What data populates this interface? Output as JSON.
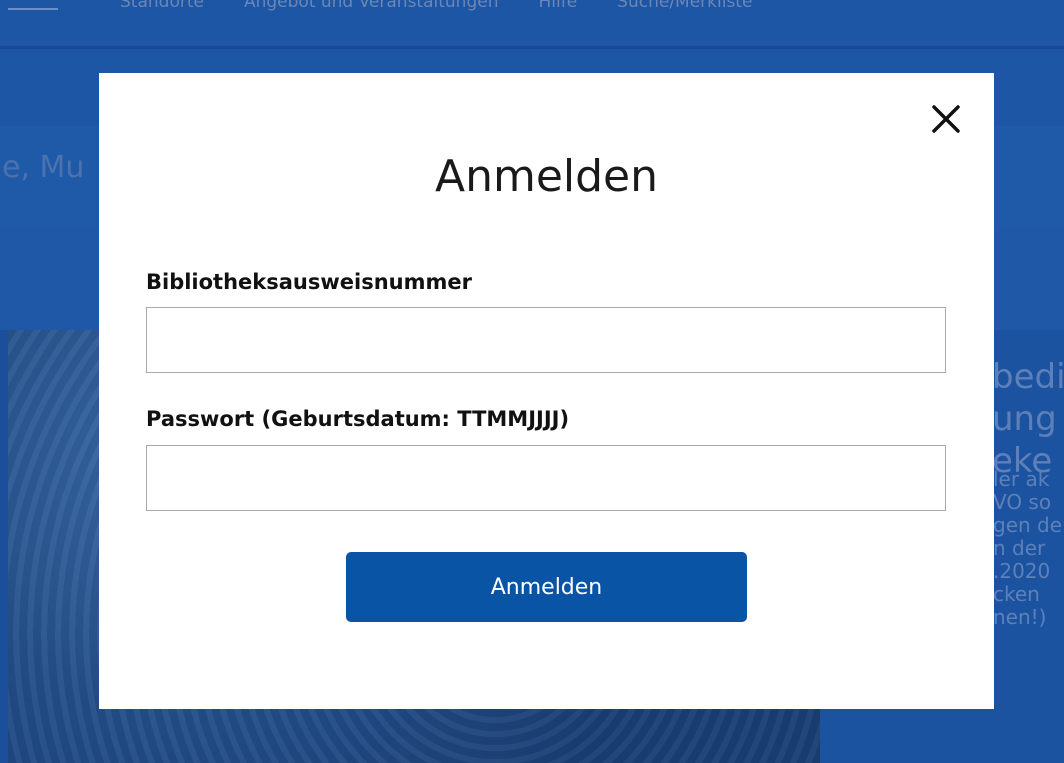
{
  "background": {
    "nav_items": [
      "Standorte",
      "Angebot und Veranstaltungen",
      "Hilfe",
      "Suche/Merkliste"
    ],
    "page_title_fragment": "e, Mu",
    "side_heading": "bedi\nung\neke",
    "side_text": "ler ak\nVO so\ngen de\nn der\n.2020\ncken\nnen!)"
  },
  "modal": {
    "title": "Anmelden",
    "card_label": "Bibliotheksausweisnummer",
    "card_value": "",
    "card_placeholder": "",
    "password_label": "Passwort (Geburtsdatum: TTMMJJJJ)",
    "password_value": "",
    "password_placeholder": "",
    "submit_label": "Anmelden",
    "close_icon": "close-icon"
  },
  "colors": {
    "overlay": "#1b4f9c",
    "button": "#0a54a6",
    "modal_bg": "#ffffff"
  }
}
